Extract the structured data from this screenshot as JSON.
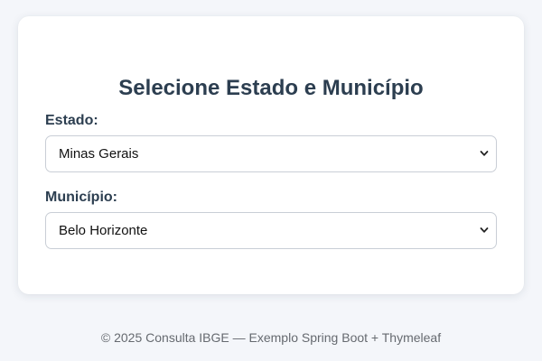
{
  "form": {
    "title": "Selecione Estado e Município",
    "estado": {
      "label": "Estado:",
      "selected": "Minas Gerais"
    },
    "municipio": {
      "label": "Município:",
      "selected": "Belo Horizonte"
    }
  },
  "footer": {
    "text": "© 2025 Consulta IBGE — Exemplo Spring Boot + Thymeleaf"
  },
  "icons": {
    "dropdown": "chevron-down-icon"
  }
}
